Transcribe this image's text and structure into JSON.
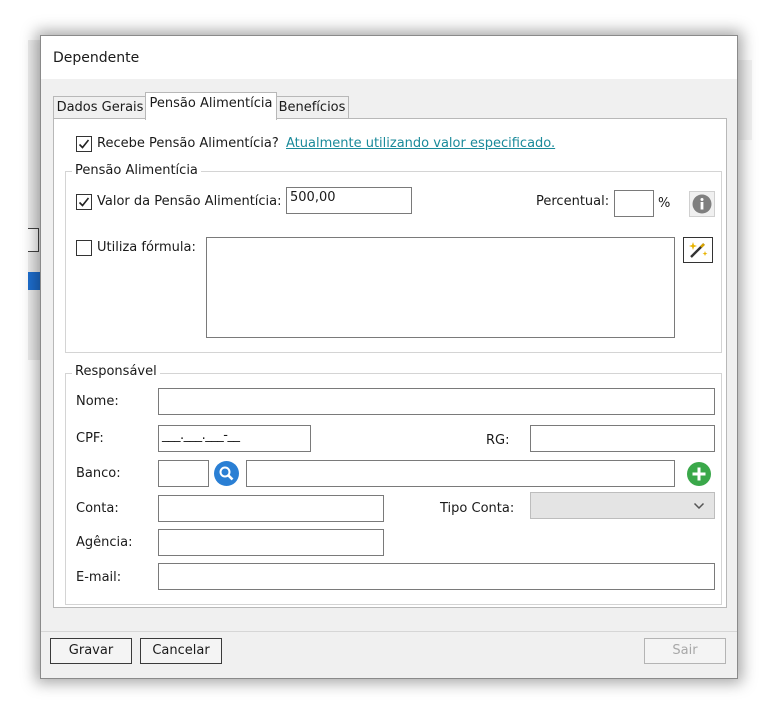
{
  "dialog": {
    "title": "Dependente"
  },
  "tabs": [
    {
      "label": "Dados Gerais"
    },
    {
      "label": "Pensão Alimentícia"
    },
    {
      "label": "Benefícios"
    }
  ],
  "pensao": {
    "recebe_label": "Recebe Pensão Alimentícia?",
    "recebe_checked": true,
    "status_link": "Atualmente utilizando valor especificado.",
    "group_title": "Pensão Alimentícia",
    "valor_label": "Valor da Pensão Alimentícia:",
    "valor_checked": true,
    "valor_value": "500,00",
    "percentual_label": "Percentual:",
    "percentual_value": "",
    "percent_sign": "%",
    "formula_label": "Utiliza fórmula:",
    "formula_checked": false,
    "formula_value": ""
  },
  "responsavel": {
    "group_title": "Responsável",
    "nome_label": "Nome:",
    "nome_value": "",
    "cpf_label": "CPF:",
    "cpf_value": "___.___.___-__",
    "rg_label": "RG:",
    "rg_value": "",
    "banco_label": "Banco:",
    "banco_code": "",
    "banco_name": "",
    "conta_label": "Conta:",
    "conta_value": "",
    "tipo_conta_label": "Tipo Conta:",
    "tipo_conta_value": "",
    "agencia_label": "Agência:",
    "agencia_value": "",
    "email_label": "E-mail:",
    "email_value": ""
  },
  "buttons": {
    "gravar": "Gravar",
    "cancelar": "Cancelar",
    "sair": "Sair"
  },
  "icons": {
    "info": "info-icon",
    "wand": "magic-wand-icon",
    "search": "search-icon",
    "add": "plus-icon",
    "dropdown": "chevron-down-icon"
  },
  "colors": {
    "link": "#1a8a9a",
    "search_icon": "#2a7fd4",
    "add_icon": "#3aa84a",
    "info_icon": "#7f7f7f"
  }
}
